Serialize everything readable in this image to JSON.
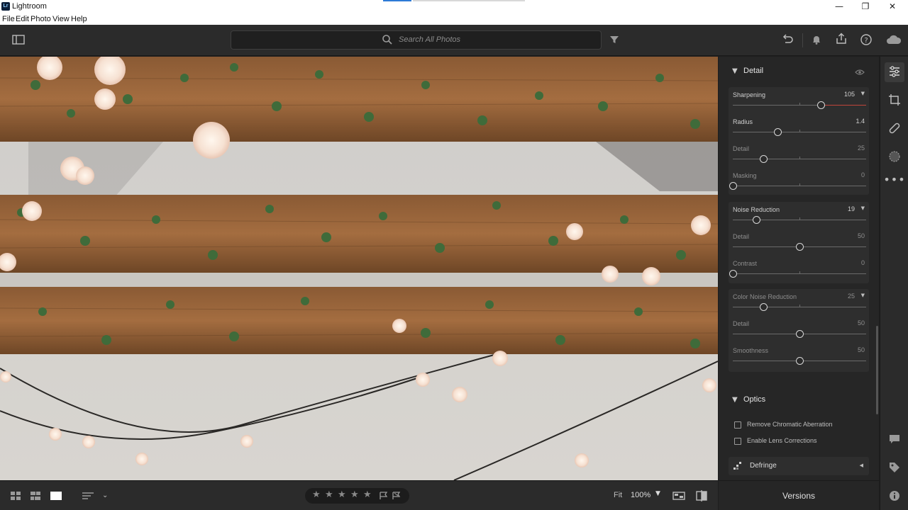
{
  "window": {
    "logo_text": "Lr",
    "title": "Lightroom",
    "controls": {
      "minimize": "—",
      "maximize": "❐",
      "close": "✕"
    }
  },
  "menu": [
    "File",
    "Edit",
    "Photo",
    "View",
    "Help"
  ],
  "toolbar": {
    "search_placeholder": "Search All Photos"
  },
  "panel": {
    "detail_title": "Detail",
    "sharpening": {
      "sliders": [
        {
          "label": "Sharpening",
          "value": "105",
          "fraction": 0.66,
          "has_menu": true,
          "dim": false
        },
        {
          "label": "Radius",
          "value": "1.4",
          "fraction": 0.34,
          "has_menu": false,
          "dim": false
        },
        {
          "label": "Detail",
          "value": "25",
          "fraction": 0.23,
          "has_menu": false,
          "dim": true
        },
        {
          "label": "Masking",
          "value": "0",
          "fraction": 0.0,
          "has_menu": false,
          "dim": true
        }
      ]
    },
    "noise": {
      "sliders": [
        {
          "label": "Noise Reduction",
          "value": "19",
          "fraction": 0.18,
          "has_menu": true,
          "dim": false
        },
        {
          "label": "Detail",
          "value": "50",
          "fraction": 0.5,
          "has_menu": false,
          "dim": true
        },
        {
          "label": "Contrast",
          "value": "0",
          "fraction": 0.0,
          "has_menu": false,
          "dim": true
        }
      ]
    },
    "color_noise": {
      "sliders": [
        {
          "label": "Color Noise Reduction",
          "value": "25",
          "fraction": 0.23,
          "has_menu": true,
          "dim": true
        },
        {
          "label": "Detail",
          "value": "50",
          "fraction": 0.5,
          "has_menu": false,
          "dim": true
        },
        {
          "label": "Smoothness",
          "value": "50",
          "fraction": 0.5,
          "has_menu": false,
          "dim": true
        }
      ]
    },
    "optics_title": "Optics",
    "optics_checkboxes": [
      {
        "label": "Remove Chromatic Aberration",
        "checked": false
      },
      {
        "label": "Enable Lens Corrections",
        "checked": false
      }
    ],
    "defringe_label": "Defringe"
  },
  "bottom": {
    "stars": [
      "★",
      "★",
      "★",
      "★",
      "★"
    ],
    "fit_label": "Fit",
    "zoom_value": "100%",
    "versions_label": "Versions"
  },
  "colors": {
    "accent_red": "#c0453a",
    "panel_bg": "#262626",
    "group_bg": "#2e2e2e"
  }
}
